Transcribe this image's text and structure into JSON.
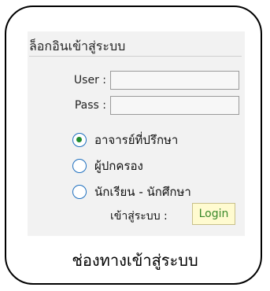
{
  "login_panel": {
    "title": "ล็อกอินเข้าสู่ระบบ",
    "user_label": "User :",
    "user_value": "",
    "pass_label": "Pass :",
    "pass_value": "",
    "roles": [
      {
        "label": "อาจารย์ที่ปรึกษา",
        "checked": true
      },
      {
        "label": "ผู้ปกครอง",
        "checked": false
      },
      {
        "label": "นักเรียน - นักศึกษา",
        "checked": false
      }
    ],
    "login_prompt": "เข้าสู่ระบบ :",
    "login_button": "Login"
  },
  "caption": "ช่องทางเข้าสู่ระบบ",
  "colors": {
    "panel_bg": "#f2f2f2",
    "radio_border": "#1e6fbf",
    "radio_selected": "#1f8a2e",
    "login_button_bg": "#fffbd0",
    "login_button_text": "#3a8a2a"
  }
}
